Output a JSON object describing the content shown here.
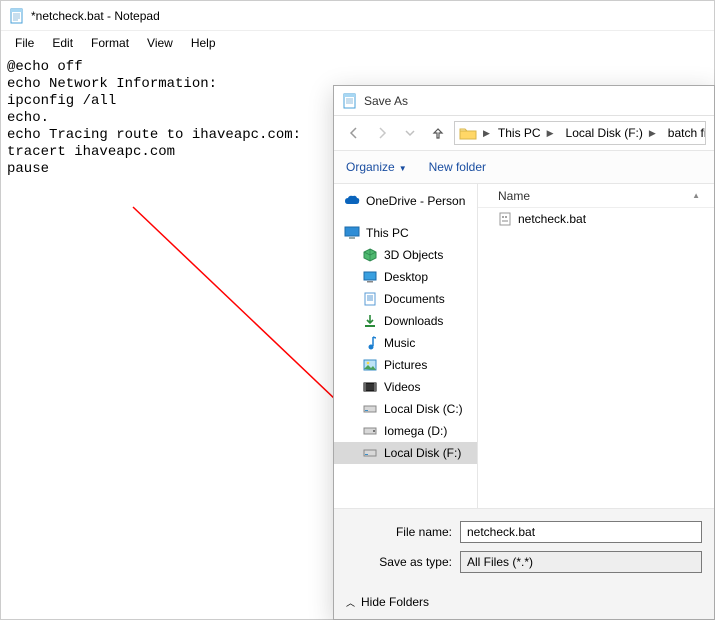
{
  "notepad": {
    "title": "*netcheck.bat - Notepad",
    "menus": [
      "File",
      "Edit",
      "Format",
      "View",
      "Help"
    ],
    "content": "@echo off\necho Network Information:\nipconfig /all\necho.\necho Tracing route to ihaveapc.com:\ntracert ihaveapc.com\npause"
  },
  "dialog": {
    "title": "Save As",
    "breadcrumbs": [
      "This PC",
      "Local Disk (F:)",
      "batch files"
    ],
    "organize": "Organize",
    "newFolder": "New folder",
    "tree": {
      "onedrive": "OneDrive - Person",
      "thispc": "This PC",
      "children": [
        "3D Objects",
        "Desktop",
        "Documents",
        "Downloads",
        "Music",
        "Pictures",
        "Videos",
        "Local Disk (C:)",
        "Iomega (D:)",
        "Local Disk (F:)"
      ]
    },
    "columns": {
      "name": "Name"
    },
    "files": [
      "netcheck.bat"
    ],
    "fileNameLabel": "File name:",
    "fileNameValue": "netcheck.bat",
    "saveTypeLabel": "Save as type:",
    "saveTypeValue": "All Files  (*.*)",
    "hideFolders": "Hide Folders"
  }
}
